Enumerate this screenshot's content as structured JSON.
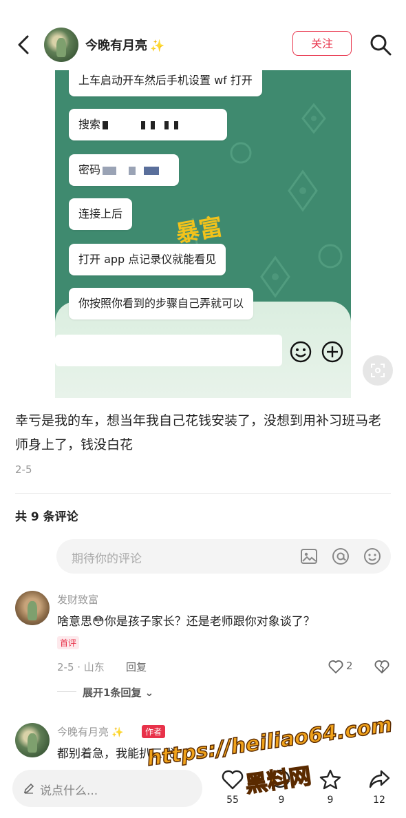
{
  "colors": {
    "accent": "#e8324a",
    "sparkle": "#f3c316",
    "card_green": "#3f8a6f"
  },
  "header": {
    "author": "今晚有月亮",
    "sparkle": "✨",
    "follow_label": "关注"
  },
  "post_image": {
    "bubbles": [
      "上车启动开车然后手机设置 wf 打开",
      "搜索",
      "密码",
      "连接上后",
      "打开 app 点记录仪就能看见",
      "你按照你看到的步骤自己弄就可以"
    ],
    "gold_art": "暴富"
  },
  "post": {
    "text": "幸亏是我的车，想当年我自己花钱安装了，没想到用补习班马老师身上了，钱没白花",
    "date": "2-5"
  },
  "comments_section": {
    "count_label": "共 9 条评论",
    "input_placeholder": "期待你的评论"
  },
  "comments": [
    {
      "user": "发财致富",
      "text": "啥意思😳你是孩子家长？还是老师跟你对象谈了？",
      "tag": "首评",
      "meta": "2-5 · 山东",
      "reply_label": "回复",
      "likes": "2",
      "expand_label": "展开1条回复 ⌄"
    },
    {
      "user": "今晚有月亮",
      "sparkle": "✨",
      "author_tag": "作者",
      "text": "都别着急，我能扒三代"
    }
  ],
  "bottom_bar": {
    "input_placeholder": "说点什么...",
    "likes": "55",
    "comments": "9",
    "favorites": "9",
    "shares": "12"
  },
  "watermark": {
    "url": "https://heiliao64.com",
    "name": "黑料网"
  }
}
